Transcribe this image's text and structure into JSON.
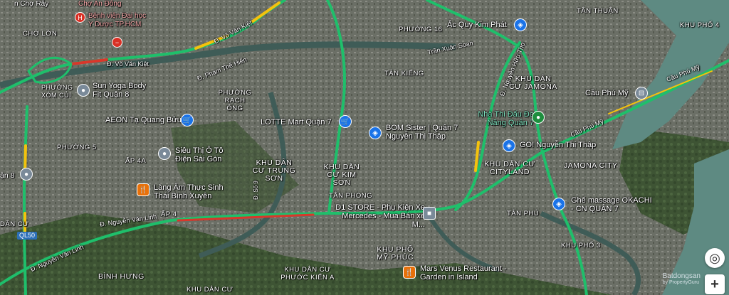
{
  "map": {
    "labels": {
      "cho_ray": "n Chợ Rẫy",
      "cho_an_dong": "Chợ An Đông",
      "cho_lon": "CHỢ LỚN",
      "benh_vien": "Bệnh viện Đại học Y Dược TP.HCM",
      "vo_van_kiet_1": "Đ. Võ Văn Kiệt",
      "vo_van_kiet_2": "Đ. Võ Văn Kiệt",
      "pham_the_hien": "Đ. Phạm Thế Hiển",
      "phuong_xom_cui": "PHƯỜNG XÓM CỦI",
      "sun_yoga": "Sun Yoga Body Fit Quận 8",
      "phuong_rach_ong": "PHƯỜNG RẠCH ÔNG",
      "aeon": "AEON Tạ Quang Bửu",
      "phuong_5": "PHƯỜNG 5",
      "phuong_16": "PHƯỜNG 16",
      "tran_xuan_soan": "Trần Xuân Soạn",
      "tan_kieng": "TÂN KIỂNG",
      "tan_thuan": "TÂN THUẬN",
      "ac_quy": "Ắc Quy Kim Phát",
      "nguyen_huu_tho": "Đ. Nguyễn Hữu Thọ",
      "kdc_jamona": "KHU DÂN CƯ JAMONA",
      "cau_phu_my": "Cầu Phú Mỹ",
      "cau_phu_my_road1": "Cầu Phú Mỹ",
      "cau_phu_my_road2": "Cầu Phú Mỹ",
      "khu_pho_4": "KHU PHỐ 4",
      "nha_thi_dau": "Nhà Thi Đấu Đa Năng Quận 7",
      "lotte": "LOTTE Mart Quận 7",
      "bom_sister": "BOM Sister | Quận 7 Nguyễn Thị Thập",
      "go": "GO! Nguyễn Thị Thập",
      "jamona_city": "JAMONA CITY",
      "sieu_thi": "Siêu Thị Ô Tô Điện Sài Gòn",
      "ap_4a": "ẤP 4A",
      "an_8": "ận 8",
      "kdc_trung_son": "KHU DÂN CƯ TRUNG SƠN",
      "kdc_kim_son": "KHU DÂN CƯ KIM SƠN",
      "kdc_cityland": "KHU DÂN CƯ CITYLAND",
      "d9": "Đ. Số 9",
      "lang_am_thuc": "Làng Ẩm Thực Sinh Thái Bình Xuyên",
      "tan_phong": "TÂN PHONG",
      "ghe_massage": "Ghế massage OKACHI - CN QUẬN 7",
      "ap_4": "ẤP 4",
      "d1_store": "D1 STORE - Phụ Kiện Xe Mercedes - Mua Bán xe M...",
      "tan_phu": "TÂN PHÚ",
      "dan_cu": "DÂN CƯ",
      "nguyen_van_linh_1": "Đ. Nguyễn Văn Linh",
      "nguyen_van_linh_2": "Đ. Nguyễn Văn Linh",
      "khu_pho_my_phuc": "KHU PHỐ MỸ PHÚC",
      "khu_pho_3": "KHU PHỐ 3",
      "binh_hung": "BÌNH HƯNG",
      "kdc_phuoc_kien": "KHU DÂN CƯ PHƯỚC KIỂN A",
      "mars_venus": "Mars Venus Restaurant - Garden in Island",
      "khu_dan_cu": "KHU DÂN CƯ",
      "ql50": "QL50"
    },
    "watermark": "Batdongsan",
    "watermark_sub": "by PropertyGuru",
    "controls": {
      "locate": "◎",
      "zoom_in": "+"
    },
    "colors": {
      "traffic_green": "#1fbf6b",
      "traffic_yellow": "#f4c20d",
      "traffic_red": "#d9372b",
      "water": "#5e8a82",
      "poi_blue": "#1a73e8"
    }
  }
}
